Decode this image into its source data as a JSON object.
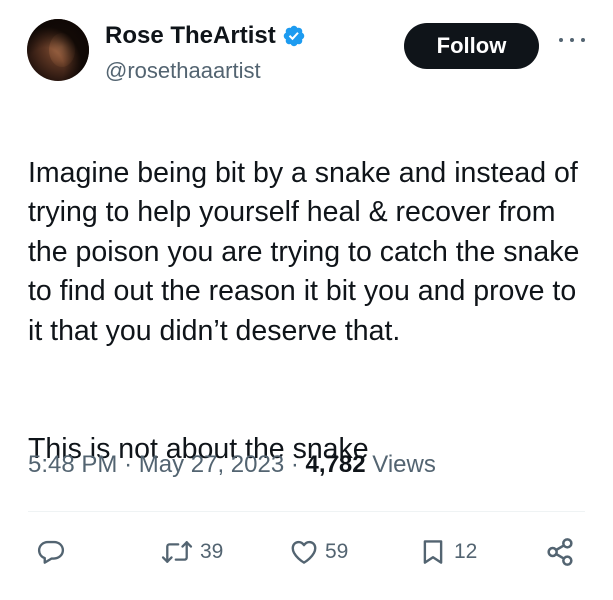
{
  "author": {
    "name": "Rose TheArtist",
    "handle": "@rosethaaartist",
    "verified": true,
    "avatar_icon": "profile-photo"
  },
  "header": {
    "follow_label": "Follow",
    "more_icon": "more-horizontal-icon"
  },
  "tweet": {
    "paragraph1": "Imagine being bit by a snake and instead of trying to help yourself heal & recover from the poison you are trying to catch the snake to find out the reason it bit you and prove to it that you didn’t deserve that.",
    "paragraph2": "This is not about the snake"
  },
  "meta": {
    "time": "5:48 PM",
    "separator": "·",
    "date": "May 27, 2023",
    "views_count": "4,782",
    "views_label": "Views"
  },
  "actions": {
    "reply": {
      "icon": "reply-icon",
      "count": ""
    },
    "retweet": {
      "icon": "retweet-icon",
      "count": "39"
    },
    "like": {
      "icon": "heart-icon",
      "count": "59"
    },
    "bookmark": {
      "icon": "bookmark-icon",
      "count": "12"
    },
    "share": {
      "icon": "share-icon",
      "count": ""
    }
  },
  "colors": {
    "text": "#0f1419",
    "secondary": "#536471",
    "verified": "#1d9bf0",
    "follow_bg": "#0f1419",
    "divider": "#eff3f4"
  }
}
